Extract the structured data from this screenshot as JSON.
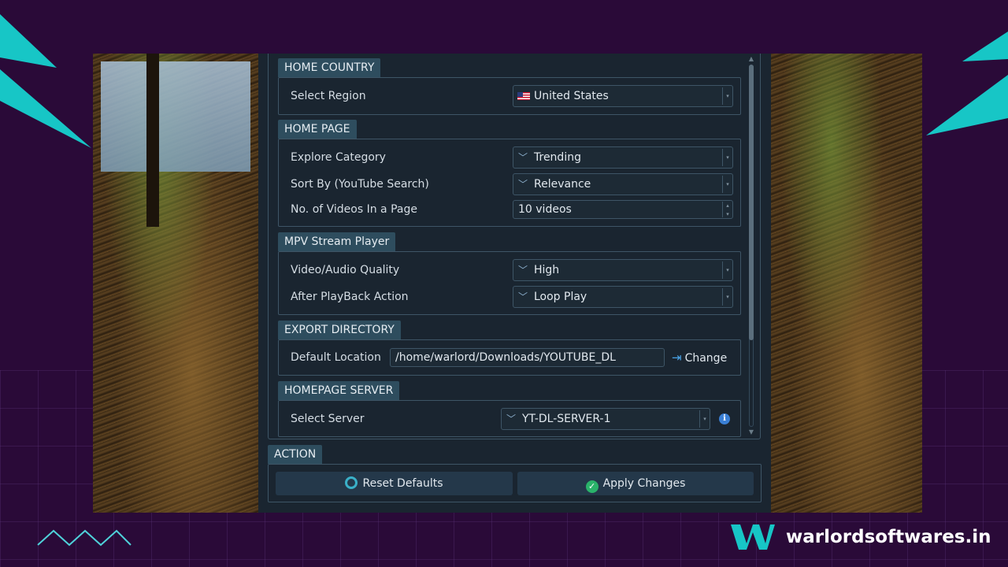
{
  "settings": {
    "home_country": {
      "title": "HOME COUNTRY",
      "select_region_label": "Select Region",
      "select_region_value": "United States"
    },
    "home_page": {
      "title": "HOME PAGE",
      "explore_category_label": "Explore Category",
      "explore_category_value": "Trending",
      "sort_by_label": "Sort By (YouTube Search)",
      "sort_by_value": "Relevance",
      "videos_per_page_label": "No. of Videos In a Page",
      "videos_per_page_value": "10 videos"
    },
    "mpv_player": {
      "title": "MPV Stream Player",
      "quality_label": "Video/Audio Quality",
      "quality_value": "High",
      "after_playback_label": "After PlayBack Action",
      "after_playback_value": "Loop Play"
    },
    "export_directory": {
      "title": "EXPORT DIRECTORY",
      "default_location_label": "Default Location",
      "default_location_value": "/home/warlord/Downloads/YOUTUBE_DL",
      "change_label": "Change"
    },
    "homepage_server": {
      "title": "HOMEPAGE SERVER",
      "select_server_label": "Select Server",
      "select_server_value": "YT-DL-SERVER-1"
    }
  },
  "action": {
    "title": "ACTION",
    "reset_label": "Reset Defaults",
    "apply_label": "Apply Changes"
  },
  "brand": {
    "name": "warlordsoftwares.in"
  },
  "colors": {
    "background": "#2a0a38",
    "panel": "#1a2530",
    "group_title": "#2e4d5e",
    "accent_cyan": "#17c6c6",
    "apply_green": "#2ab36a"
  },
  "icons": {
    "dropdown": "chevron-down-icon",
    "flag": "us-flag-icon",
    "change": "export-icon",
    "info": "info-icon",
    "reset": "refresh-icon",
    "apply": "check-circle-icon"
  }
}
